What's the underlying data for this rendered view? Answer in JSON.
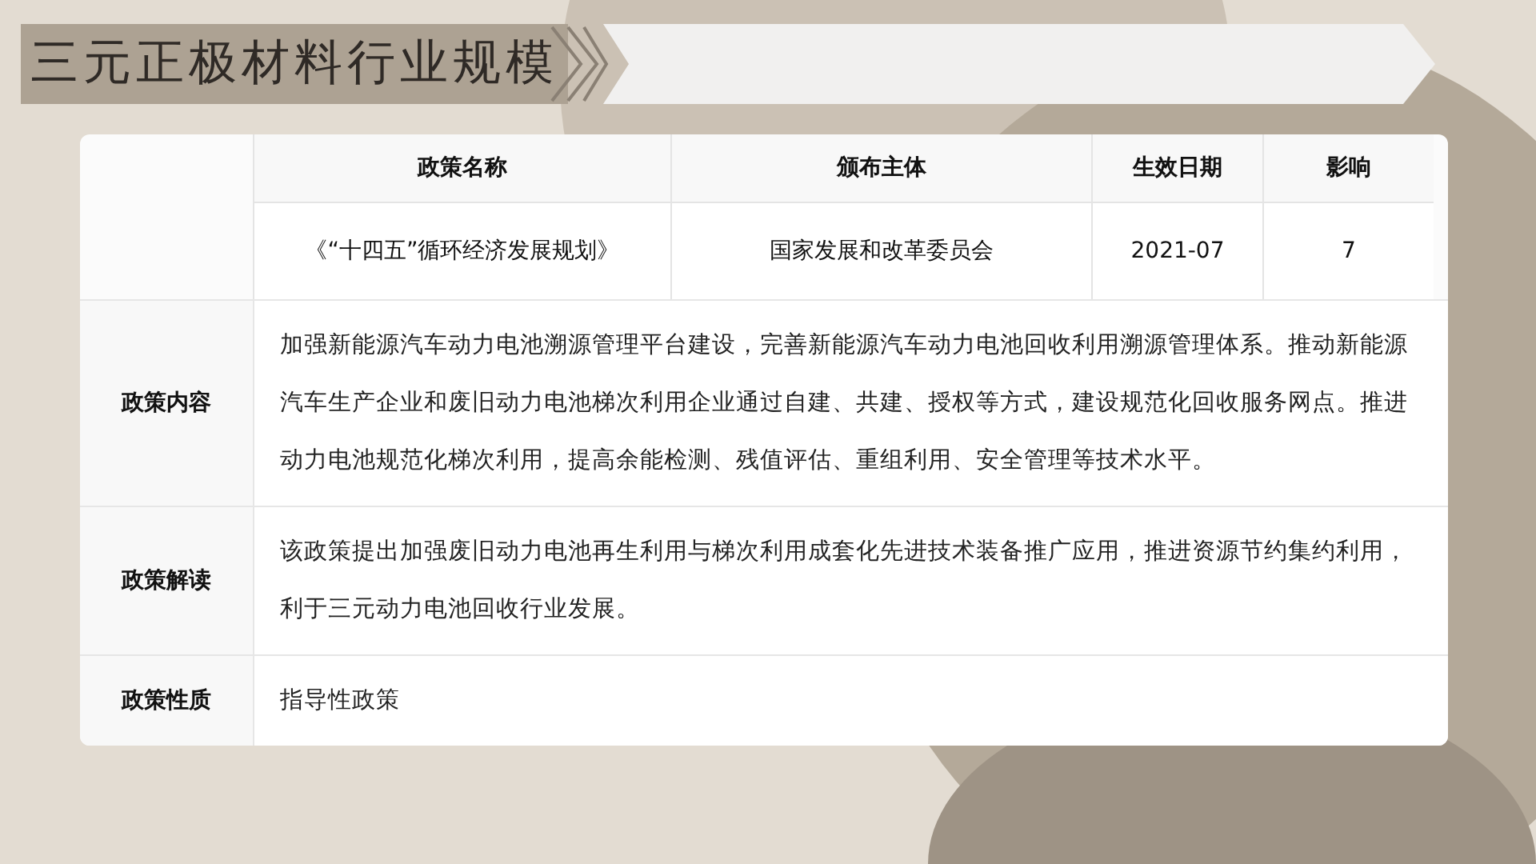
{
  "title": "三元正极材料行业规模",
  "table": {
    "columns": [
      "政策名称",
      "颁布主体",
      "生效日期",
      "影响"
    ],
    "row": [
      "《“十四五”循环经济发展规划》",
      "国家发展和改革委员会",
      "2021-07",
      "7"
    ]
  },
  "details": [
    {
      "label": "政策内容",
      "text": "加强新能源汽车动力电池溯源管理平台建设，完善新能源汽车动力电池回收利用溯源管理体系。推动新能源汽车生产企业和废旧动力电池梯次利用企业通过自建、共建、授权等方式，建设规范化回收服务网点。推进动力电池规范化梯次利用，提高余能检测、残值评估、重组利用、安全管理等技术水平。"
    },
    {
      "label": "政策解读",
      "text": "该政策提出加强废旧动力电池再生利用与梯次利用成套化先进技术装备推广应用，推进资源节约集约利用，利于三元动力电池回收行业发展。"
    },
    {
      "label": "政策性质",
      "text": "指导性政策"
    }
  ]
}
